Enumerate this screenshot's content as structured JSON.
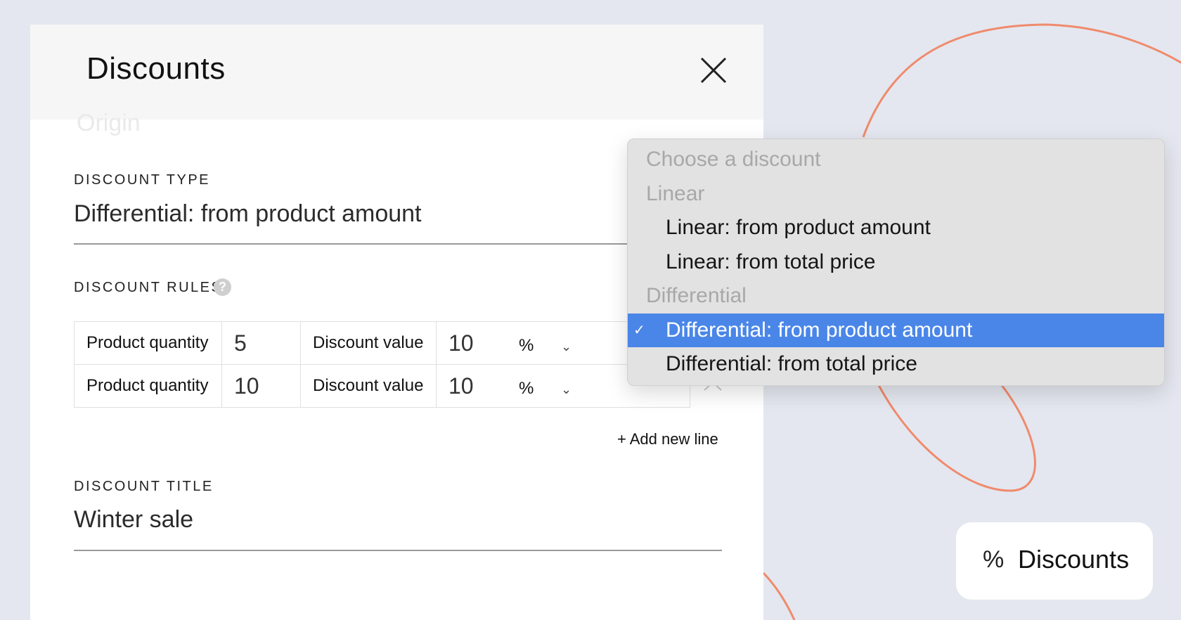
{
  "panel": {
    "title": "Discounts",
    "ghost_text": "Origin"
  },
  "discount_type": {
    "label": "DISCOUNT TYPE",
    "value": "Differential: from product amount"
  },
  "discount_rules": {
    "label": "DISCOUNT RULES",
    "help_icon": "?",
    "rows": [
      {
        "qty_label": "Product quantity",
        "qty": "5",
        "value_label": "Discount value",
        "value": "10",
        "unit": "%",
        "chevron": "⌄"
      },
      {
        "qty_label": "Product quantity",
        "qty": "10",
        "value_label": "Discount value",
        "value": "10",
        "unit": "%",
        "chevron": "⌄"
      }
    ],
    "add_line": "+ Add new line"
  },
  "discount_title": {
    "label": "DISCOUNT TITLE",
    "value": "Winter sale"
  },
  "dropdown": {
    "placeholder": "Choose a discount",
    "group1": "Linear",
    "option1": "Linear: from product amount",
    "option2": "Linear: from total price",
    "group2": "Differential",
    "option3": "Differential: from product amount",
    "option4": "Differential: from total price",
    "check_mark": "✓",
    "selected_option": "Differential: from product amount"
  },
  "badge": {
    "icon": "%",
    "label": "Discounts"
  },
  "colors": {
    "background": "#e4e7ef",
    "accent_curve": "#f08a6c",
    "selected_highlight": "#4a86e8"
  },
  "icons": {
    "close": "close-icon",
    "help": "help-icon",
    "chevron": "chevron-down-icon",
    "caret": "chevron-up-icon",
    "percent": "percent-icon"
  }
}
